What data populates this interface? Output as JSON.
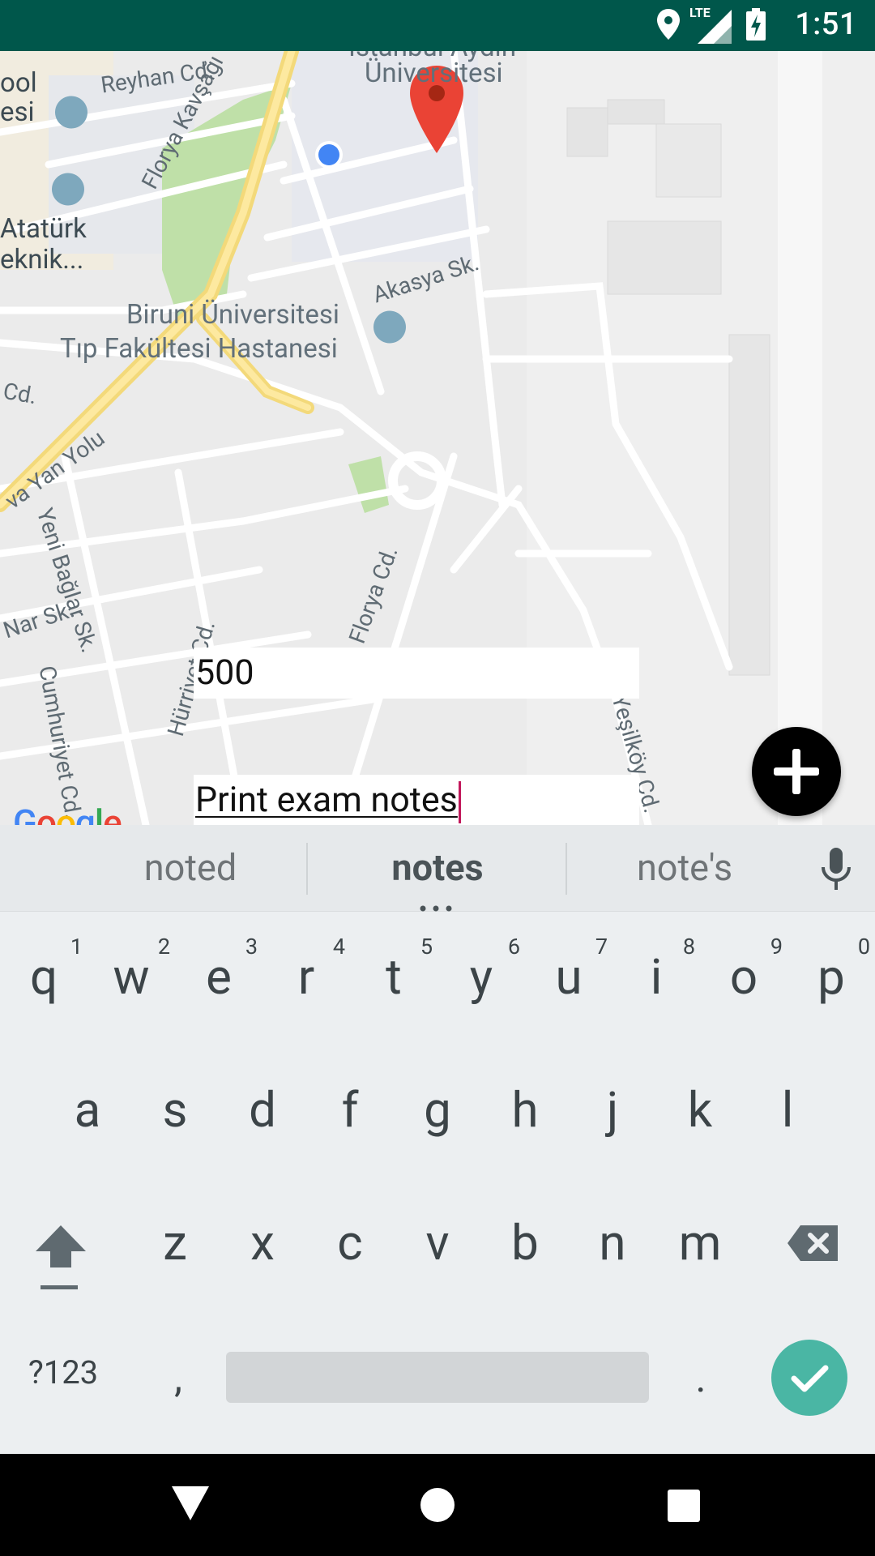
{
  "status_bar": {
    "time": "1:51",
    "network": "LTE",
    "icons": [
      "location-icon",
      "lte-signal-icon",
      "battery-charging-icon"
    ]
  },
  "map": {
    "labels": {
      "reyhan": "Reyhan Cd.",
      "istanbul_top": "İstanbul Aydın",
      "universitesi": "Üniversitesi",
      "ool": "ool",
      "esi": "esi",
      "ataturk": "Atatürk",
      "teknik": "eknik...",
      "florya_kavsagi": "Florya Kavşağı",
      "biruni1": "Biruni Üniversitesi",
      "biruni2": "Tıp Fakültesi Hastanesi",
      "akasya": "Akasya Sk.",
      "cd": "Cd.",
      "yan_yolu": "va Yan Yolu",
      "yeni_baglar": "Yeni Bağlar Sk.",
      "florya_cd": "Florya Cd.",
      "nar": "Nar Sk.",
      "hurriyet": "Hürriyet Cd.",
      "cumhuriyet": "Cumhuriyet Cd.",
      "yesilkoy": "Yeşilköy Cd."
    },
    "google_logo": "Google"
  },
  "inputs": {
    "radius_value": "500",
    "note_value": "Print exam notes"
  },
  "fab": {
    "icon": "plus-icon"
  },
  "keyboard": {
    "suggestions": [
      "noted",
      "notes",
      "note's"
    ],
    "row1": [
      "q",
      "w",
      "e",
      "r",
      "t",
      "y",
      "u",
      "i",
      "o",
      "p"
    ],
    "row1_hints": [
      "1",
      "2",
      "3",
      "4",
      "5",
      "6",
      "7",
      "8",
      "9",
      "0"
    ],
    "row2": [
      "a",
      "s",
      "d",
      "f",
      "g",
      "h",
      "j",
      "k",
      "l"
    ],
    "row3": [
      "z",
      "x",
      "c",
      "v",
      "b",
      "n",
      "m"
    ],
    "symbols_key": "?123",
    "comma_key": ",",
    "period_key": "."
  },
  "colors": {
    "status_bar": "#00574b",
    "map_pin": "#ea4335",
    "location_dot": "#4285f4",
    "enter_key": "#4ab6a4"
  }
}
